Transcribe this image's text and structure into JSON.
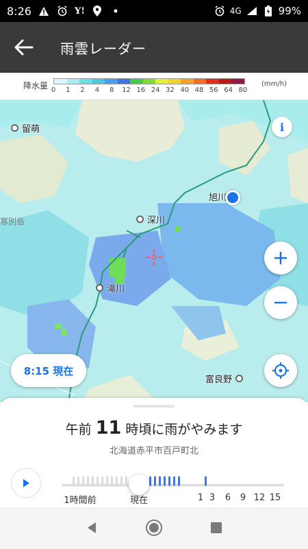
{
  "status": {
    "time": "8:26",
    "signal": "4G",
    "battery": "99%",
    "yahoo": "Y!"
  },
  "header": {
    "title": "雨雲レーダー"
  },
  "legend": {
    "label": "降水量",
    "unit": "(mm/h)",
    "ticks": [
      "0",
      "1",
      "2",
      "4",
      "8",
      "12",
      "16",
      "24",
      "32",
      "40",
      "48",
      "56",
      "64",
      "80"
    ],
    "colors": [
      "#dcf7fb",
      "#a6eef0",
      "#6cdede",
      "#4fc6e6",
      "#4a9ef0",
      "#3f73e6",
      "#46c84a",
      "#7ddc3a",
      "#e6ee3c",
      "#f7d036",
      "#f7a02c",
      "#f26c2a",
      "#e23020",
      "#b61a1a",
      "#8e1a4a"
    ]
  },
  "map": {
    "places": [
      {
        "name": "留萌"
      },
      {
        "name": "旭川"
      },
      {
        "name": "深川"
      },
      {
        "name": "滝川"
      },
      {
        "name": "富良野"
      }
    ],
    "side_label": "寒別岳",
    "info_label": "i",
    "time_pill": "8:15 現在"
  },
  "sheet": {
    "forecast_prefix": "午前",
    "forecast_hour": "11",
    "forecast_suffix": "時頃に雨がやみます",
    "address": "北海道赤平市百戸町北",
    "timeline_labels": [
      "1時間前",
      "現在",
      "1",
      "3",
      "6",
      "9",
      "12",
      "15"
    ]
  },
  "colors": {
    "accent": "#1a73e8",
    "appbar": "#3a3a3a"
  }
}
